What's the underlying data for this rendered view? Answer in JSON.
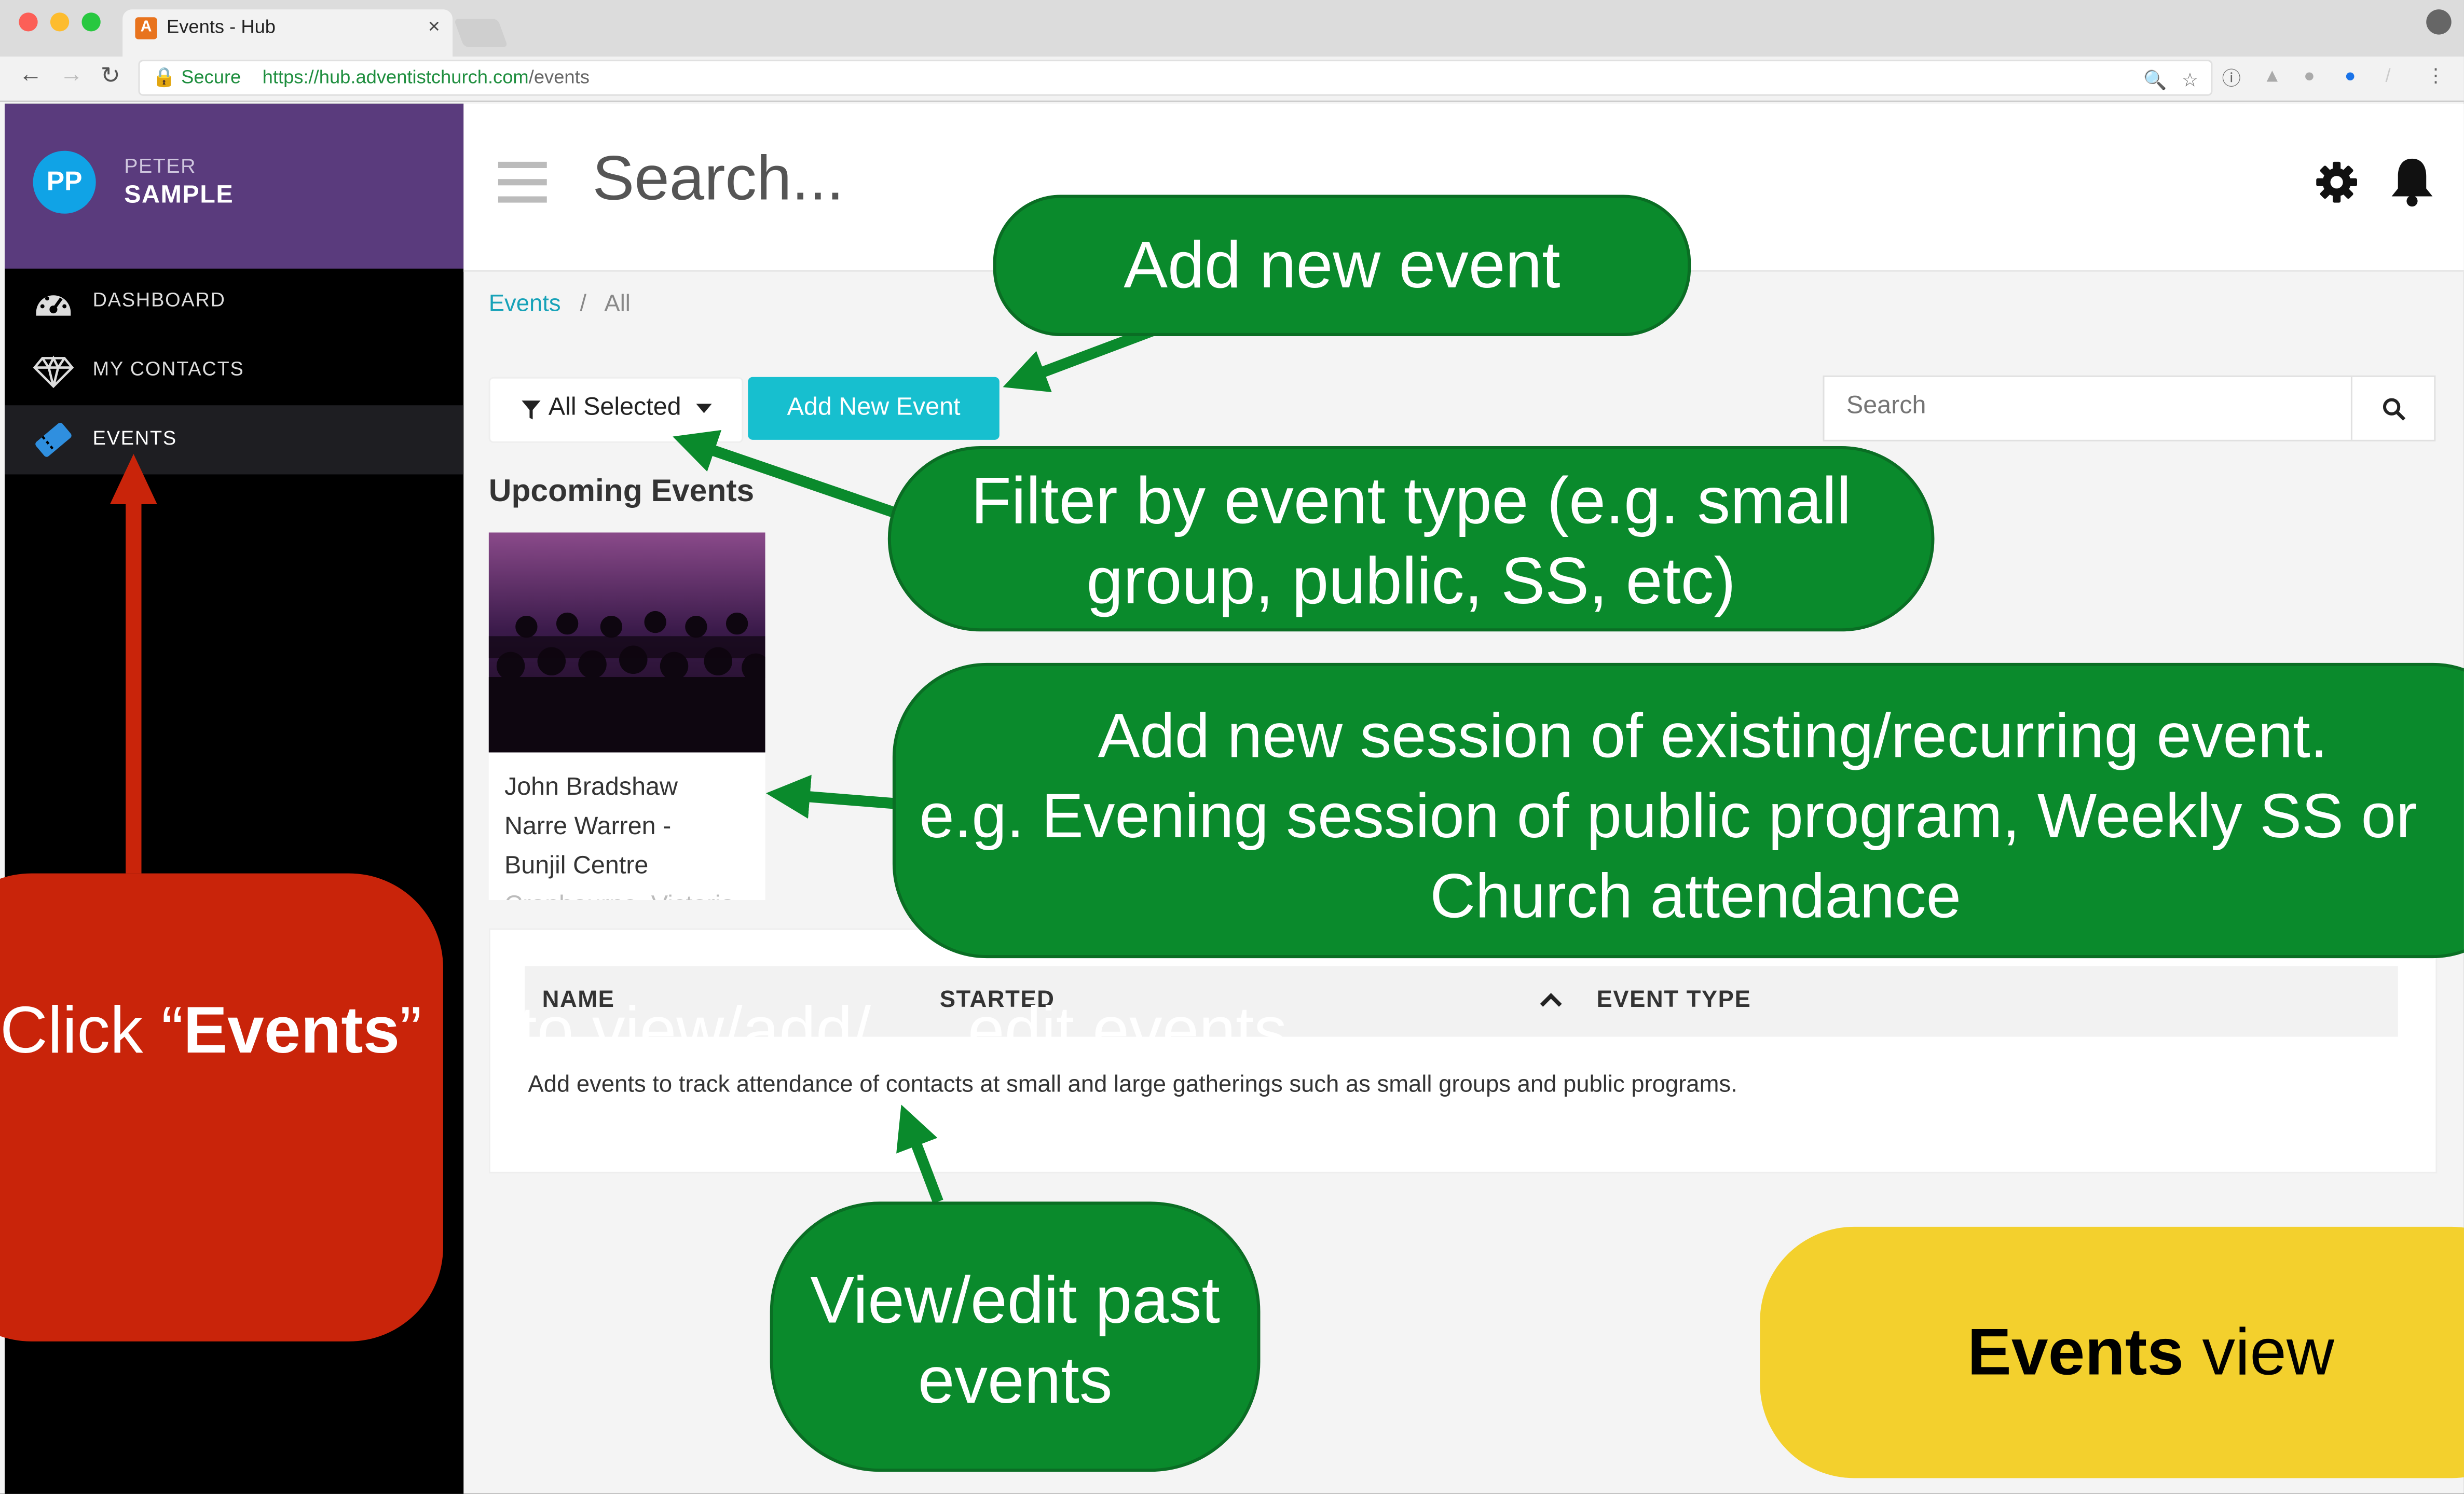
{
  "browser": {
    "tab_title": "Events - Hub",
    "tab_close": "×",
    "secure_label": "Secure",
    "url_scheme_host": "https://hub.adventistchurch.com",
    "url_path": "/events"
  },
  "user": {
    "initials": "PP",
    "first_name": "PETER",
    "last_name": "SAMPLE"
  },
  "sidebar": {
    "items": [
      {
        "label": "DASHBOARD",
        "icon": "dashboard-icon"
      },
      {
        "label": "MY CONTACTS",
        "icon": "diamond-icon"
      },
      {
        "label": "EVENTS",
        "icon": "ticket-icon",
        "active": true
      }
    ]
  },
  "topbar": {
    "search_text": "Search..."
  },
  "breadcrumb": {
    "root": "Events",
    "separator": "/",
    "current": "All"
  },
  "toolbar": {
    "filter_label": "All Selected",
    "add_button": "Add New Event",
    "search_placeholder": "Search"
  },
  "upcoming": {
    "heading": "Upcoming Events",
    "card": {
      "line1": "John Bradshaw",
      "line2": "Narre Warren -",
      "line3": "Bunjil Centre",
      "line4": "Cranbourne, Victoria"
    }
  },
  "table": {
    "columns": [
      "NAME",
      "STARTED",
      "EVENT TYPE"
    ],
    "sort_indicator": "^",
    "empty_message": "Add events to track attendance of contacts at small and large gatherings such as small groups and public programs."
  },
  "annotations": {
    "add_event": "Add new event",
    "filter_line1": "Filter by event type  (e.g. small",
    "filter_line2": "group, public, SS, etc)",
    "session_line1": "Add new session of existing/recurring event.",
    "session_line2": "e.g. Evening session of public program, Weekly SS or",
    "session_line3": "Church attendance",
    "past_line1": "View/edit past",
    "past_line2": "events",
    "click_prefix": "Click “",
    "click_bold": "Events",
    "click_suffix": "”",
    "click_line2": "to view/add/",
    "click_line3": "edit events",
    "view_bold": "Events",
    "view_rest": " view"
  },
  "colors": {
    "sidebar_profile": "#5a3b7d",
    "accent_teal": "#17bfcf",
    "annotation_green": "#0a8a2c",
    "annotation_red": "#c9240a",
    "annotation_yellow": "#f3d02d"
  }
}
